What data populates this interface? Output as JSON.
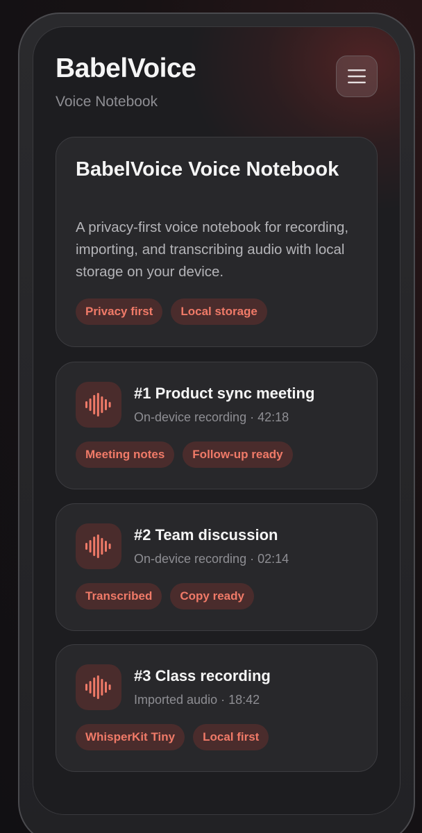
{
  "app": {
    "title": "BabelVoice",
    "subtitle": "Voice Notebook",
    "menu_icon": "hamburger-menu-icon"
  },
  "hero": {
    "title": "BabelVoice Voice Notebook",
    "description": "A privacy-first voice notebook for recording, importing, and transcribing audio with local storage on your device.",
    "tags": [
      "Privacy first",
      "Local storage"
    ]
  },
  "recordings": [
    {
      "title": "#1 Product sync meeting",
      "meta": "On-device recording · 42:18",
      "icon": "waveform-icon",
      "tags": [
        "Meeting notes",
        "Follow-up ready"
      ]
    },
    {
      "title": "#2 Team discussion",
      "meta": "On-device recording · 02:14",
      "icon": "waveform-icon",
      "tags": [
        "Transcribed",
        "Copy ready"
      ]
    },
    {
      "title": "#3 Class recording",
      "meta": "Imported audio · 18:42",
      "icon": "waveform-icon",
      "tags": [
        "WhisperKit Tiny",
        "Local first"
      ]
    }
  ],
  "colors": {
    "accent": "#f07a68",
    "tag_background": "#4a2c2c",
    "card_background": "#28282b",
    "screen_background": "#1d1d20"
  }
}
